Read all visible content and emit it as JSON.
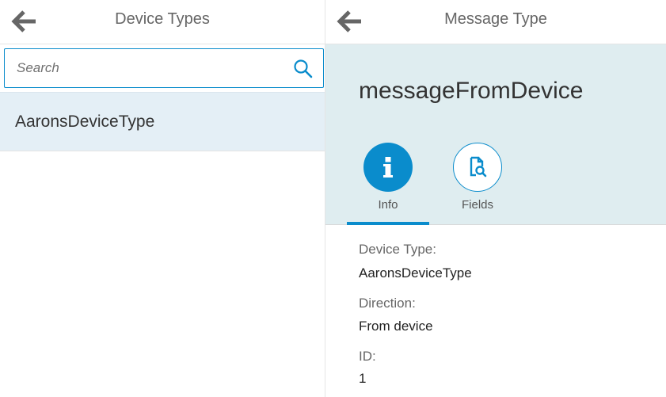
{
  "left_pane": {
    "title": "Device Types",
    "search": {
      "placeholder": "Search",
      "value": ""
    },
    "items": [
      {
        "label": "AaronsDeviceType"
      }
    ]
  },
  "right_pane": {
    "title": "Message Type",
    "object_title": "messageFromDevice",
    "tabs": [
      {
        "label": "Info",
        "icon": "info-icon",
        "selected": true
      },
      {
        "label": "Fields",
        "icon": "document-search-icon",
        "selected": false
      }
    ],
    "details": [
      {
        "label": "Device Type:",
        "value": "AaronsDeviceType"
      },
      {
        "label": "Direction:",
        "value": "From device"
      },
      {
        "label": "ID:",
        "value": "1"
      }
    ]
  },
  "colors": {
    "accent": "#0a8ccc",
    "selected_row": "#e4eff6",
    "object_header_bg": "#dfedf0"
  }
}
